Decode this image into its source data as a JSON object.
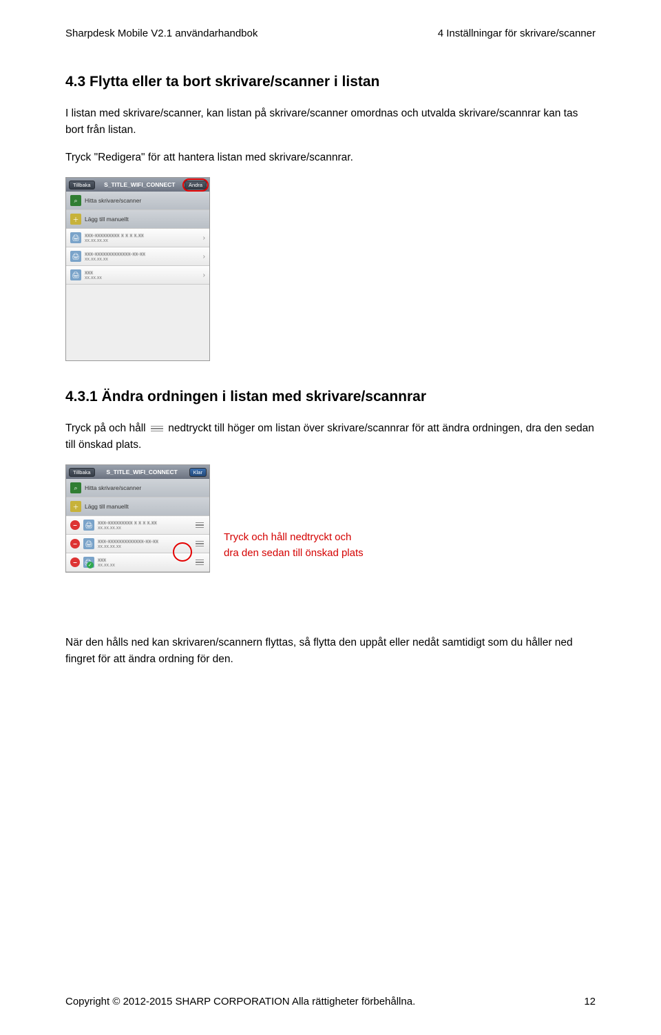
{
  "header": {
    "left": "Sharpdesk Mobile V2.1 användarhandbok",
    "right": "4 Inställningar för skrivare/scanner"
  },
  "section43": {
    "title": "4.3   Flytta eller ta bort skrivare/scanner i listan",
    "p1": "I listan med skrivare/scanner, kan listan på skrivare/scanner omordnas och utvalda skrivare/scannrar kan tas bort från listan.",
    "p2": "Tryck \"Redigera\" för att hantera listan med skrivare/scannrar."
  },
  "shot1": {
    "back": "Tillbaka",
    "title": "S_TITLE_WIFI_CONNECT",
    "edit": "Ändra",
    "find": "Hitta skrivare/scanner",
    "add": "Lägg till manuellt",
    "items": [
      {
        "main": "xxx-xxxxxxxxx   x x x x.xx",
        "sub": "xx.xx.xx.xx"
      },
      {
        "main": "xxx-xxxxxxxxxxxxx-xx-xx",
        "sub": "xx.xx.xx.xx"
      },
      {
        "main": "xxx",
        "sub": "xx.xx.xx"
      }
    ]
  },
  "section431": {
    "title": "4.3.1   Ändra ordningen i listan med skrivare/scannrar",
    "p_before_icon": "Tryck på och håll",
    "p_after_icon": "nedtryckt till höger om listan över skrivare/scannrar för att ändra ordningen, dra den sedan till önskad plats."
  },
  "shot2": {
    "back": "Tillbaka",
    "title": "S_TITLE_WIFI_CONNECT",
    "done": "Klar",
    "find": "Hitta skrivare/scanner",
    "add": "Lägg till manuellt",
    "items": [
      {
        "main": "xxx-xxxxxxxxx   x x x x.xx",
        "sub": "xx.xx.xx.xx"
      },
      {
        "main": "xxx-xxxxxxxxxxxxx-xx-xx",
        "sub": "xx.xx.xx.xx"
      },
      {
        "main": "xxx",
        "sub": "xx.xx.xx"
      }
    ]
  },
  "callout": {
    "line1": "Tryck och håll nedtryckt och",
    "line2": "dra den sedan till önskad plats"
  },
  "para_last": "När den hålls ned kan skrivaren/scannern flyttas, så flytta den uppåt eller nedåt samtidigt som du håller ned fingret för att ändra ordning för den.",
  "footer": {
    "left": "Copyright © 2012-2015 SHARP CORPORATION Alla rättigheter förbehållna.",
    "right": "12"
  }
}
